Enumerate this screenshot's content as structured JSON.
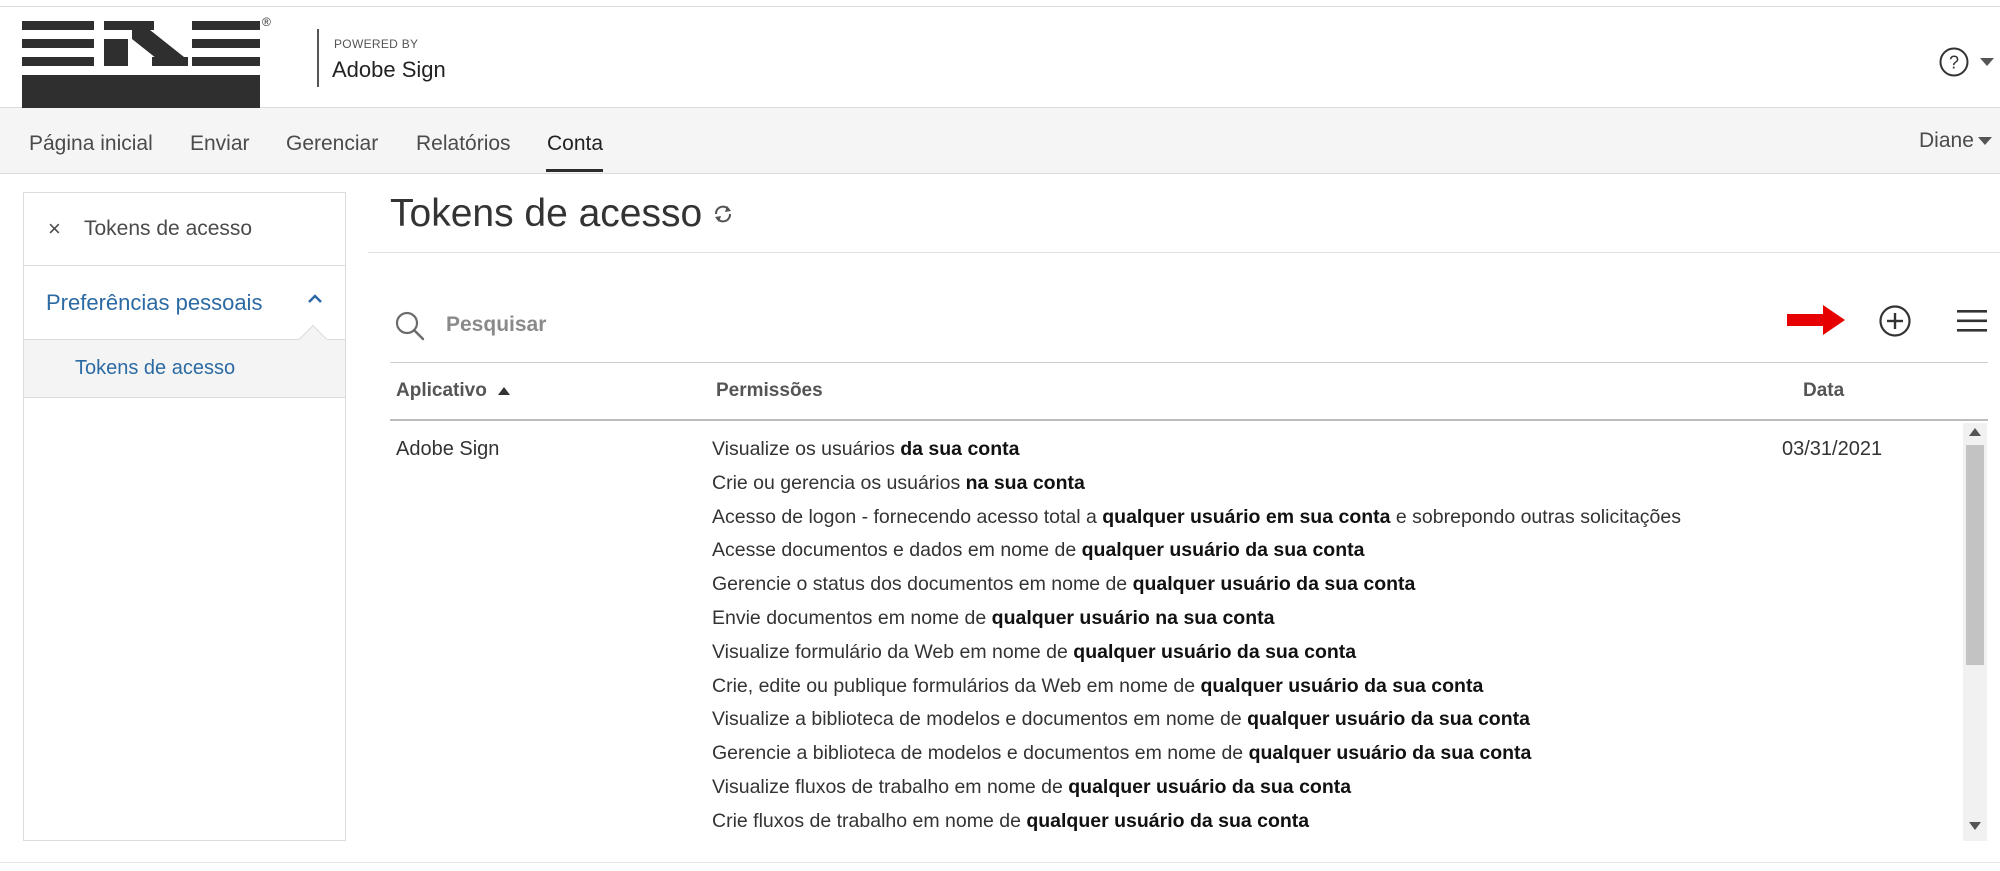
{
  "brand": {
    "logo": "ens-logo",
    "registered": "®",
    "powered_by": "POWERED BY",
    "product": "Adobe Sign"
  },
  "header": {
    "help_icon": "question-circle-icon"
  },
  "nav": {
    "items": [
      {
        "label": "Página inicial"
      },
      {
        "label": "Enviar"
      },
      {
        "label": "Gerenciar"
      },
      {
        "label": "Relatórios"
      },
      {
        "label": "Conta"
      }
    ],
    "active": "Conta",
    "user": "Diane"
  },
  "sidebar": {
    "close_symbol": "×",
    "title": "Tokens de acesso",
    "section": "Preferências pessoais",
    "subitem": "Tokens de acesso"
  },
  "main": {
    "title": "Tokens de acesso",
    "search_placeholder": "Pesquisar",
    "annotation_arrow_color": "#e60000"
  },
  "table": {
    "columns": [
      "Aplicativo",
      "Permissões",
      "Data"
    ],
    "sorted_by": "Aplicativo",
    "sort_direction": "ascending",
    "row": {
      "app": "Adobe Sign",
      "date": "03/31/2021",
      "permissions": [
        {
          "text": "Visualize os usuários ",
          "bold": "da sua conta",
          "suffix": ""
        },
        {
          "text": "Crie ou gerencia os usuários ",
          "bold": "na sua conta",
          "suffix": ""
        },
        {
          "text": "Acesso de logon - fornecendo acesso total a ",
          "bold": "qualquer usuário em sua conta",
          "suffix": " e sobrepondo outras solicitações"
        },
        {
          "text": "Acesse documentos e dados em nome de ",
          "bold": "qualquer usuário da sua conta",
          "suffix": ""
        },
        {
          "text": "Gerencie o status dos documentos em nome de ",
          "bold": "qualquer usuário da sua conta",
          "suffix": ""
        },
        {
          "text": "Envie documentos em nome de ",
          "bold": "qualquer usuário na sua conta",
          "suffix": ""
        },
        {
          "text": "Visualize formulário da Web em nome de ",
          "bold": "qualquer usuário da sua conta",
          "suffix": ""
        },
        {
          "text": "Crie, edite ou publique formulários da Web em nome de ",
          "bold": "qualquer usuário da sua conta",
          "suffix": ""
        },
        {
          "text": "Visualize a biblioteca de modelos e documentos em nome de ",
          "bold": "qualquer usuário da sua conta",
          "suffix": ""
        },
        {
          "text": "Gerencie a biblioteca de modelos e documentos em nome de ",
          "bold": "qualquer usuário da sua conta",
          "suffix": ""
        },
        {
          "text": "Visualize fluxos de trabalho em nome de ",
          "bold": "qualquer usuário da sua conta",
          "suffix": ""
        },
        {
          "text": "Crie fluxos de trabalho em nome de ",
          "bold": "qualquer usuário da sua conta",
          "suffix": ""
        }
      ]
    }
  }
}
